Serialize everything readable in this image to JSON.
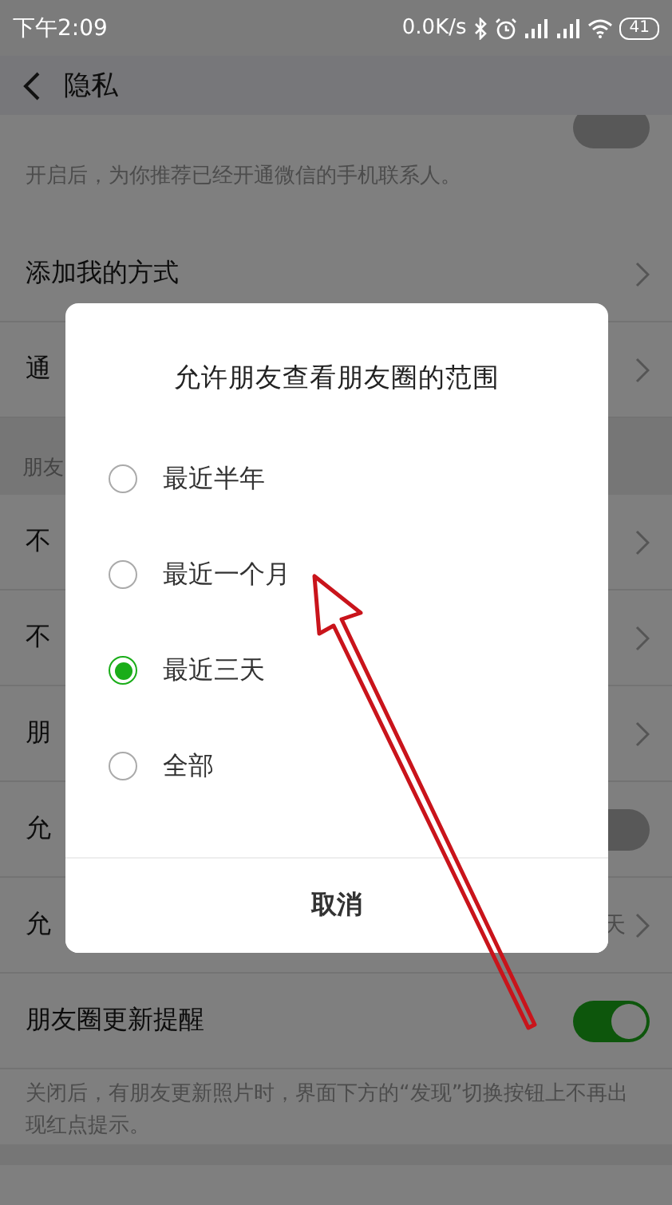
{
  "status_bar": {
    "time": "下午2:09",
    "net_speed": "0.0K/s",
    "battery": "41"
  },
  "nav": {
    "title": "隐私"
  },
  "rows": [
    {
      "kind": "cut_toggle",
      "on": false
    },
    {
      "kind": "note",
      "text": "开启后，为你推荐已经开通微信的手机联系人。"
    },
    {
      "kind": "link",
      "label": "添加我的方式"
    },
    {
      "kind": "link",
      "label": "通"
    },
    {
      "kind": "gap"
    },
    {
      "kind": "header",
      "label": "朋友"
    },
    {
      "kind": "link",
      "label": "不"
    },
    {
      "kind": "link",
      "label": "不"
    },
    {
      "kind": "link",
      "label": "朋"
    },
    {
      "kind": "toggle",
      "label": "允",
      "on": false
    },
    {
      "kind": "link",
      "label": "允",
      "value": "天"
    },
    {
      "kind": "toggle",
      "label": "朋友圈更新提醒",
      "on": true
    },
    {
      "kind": "note",
      "text": "关闭后，有朋友更新照片时，界面下方的“发现”切换按钮上不再出现红点提示。"
    },
    {
      "kind": "gap"
    }
  ],
  "dialog": {
    "title": "允许朋友查看朋友圈的范围",
    "options": [
      {
        "label": "最近半年",
        "selected": false
      },
      {
        "label": "最近一个月",
        "selected": false
      },
      {
        "label": "最近三天",
        "selected": true
      },
      {
        "label": "全部",
        "selected": false
      }
    ],
    "cancel": "取消"
  }
}
